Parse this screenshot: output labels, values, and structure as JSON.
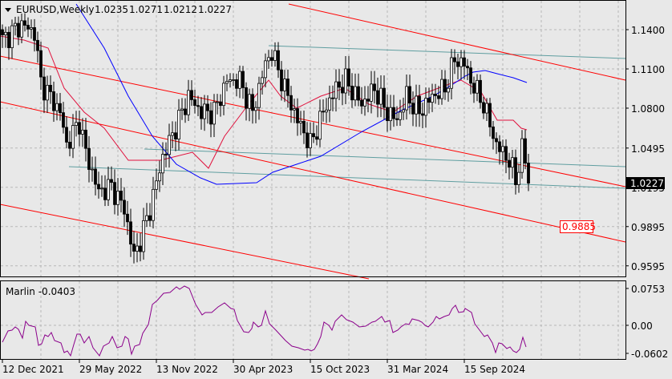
{
  "header": {
    "symbol": "EURUSD,Weekly",
    "open": "1.0235",
    "high": "1.0271",
    "low": "1.0212",
    "close": "1.0227"
  },
  "price_axis": [
    "1.1400",
    "1.1100",
    "1.0800",
    "1.0495",
    "1.0195",
    "0.9895",
    "0.9595"
  ],
  "current_price": "1.0227",
  "target_label": "0.9885",
  "indicator": {
    "label": "Marlin -0.0403",
    "axis": [
      "0.0753",
      "0.00",
      "-0.0602"
    ]
  },
  "time_axis": [
    "12 Dec 2021",
    "29 May 2022",
    "13 Nov 2022",
    "30 Apr 2023",
    "15 Oct 2023",
    "31 Mar 2024",
    "15 Sep 2024"
  ],
  "colors": {
    "bg": "#e8e8e8",
    "trend": "#ff0000",
    "channel": "#5f9ea0",
    "ma_fast": "#e0103c",
    "ma_slow": "#0000ff",
    "indicator": "#8b008b"
  },
  "price_waypoints": [
    [
      0,
      1.132
    ],
    [
      6,
      1.144
    ],
    [
      10,
      1.138
    ],
    [
      12,
      1.1
    ],
    [
      18,
      1.077
    ],
    [
      20,
      1.052
    ],
    [
      24,
      1.07
    ],
    [
      26,
      1.046
    ],
    [
      30,
      1.016
    ],
    [
      34,
      1.02
    ],
    [
      38,
      1.003
    ],
    [
      41,
      0.967
    ],
    [
      43,
      0.979
    ],
    [
      46,
      1.003
    ],
    [
      50,
      1.043
    ],
    [
      55,
      1.071
    ],
    [
      58,
      1.089
    ],
    [
      62,
      1.077
    ],
    [
      66,
      1.077
    ],
    [
      70,
      1.101
    ],
    [
      74,
      1.101
    ],
    [
      78,
      1.077
    ],
    [
      82,
      1.114
    ],
    [
      84,
      1.123
    ],
    [
      88,
      1.095
    ],
    [
      92,
      1.071
    ],
    [
      96,
      1.052
    ],
    [
      100,
      1.077
    ],
    [
      104,
      1.095
    ],
    [
      107,
      1.101
    ],
    [
      112,
      1.083
    ],
    [
      116,
      1.095
    ],
    [
      120,
      1.077
    ],
    [
      123,
      1.071
    ],
    [
      126,
      1.089
    ],
    [
      130,
      1.077
    ],
    [
      134,
      1.089
    ],
    [
      138,
      1.095
    ],
    [
      141,
      1.117
    ],
    [
      144,
      1.114
    ],
    [
      146,
      1.101
    ],
    [
      150,
      1.083
    ],
    [
      154,
      1.052
    ],
    [
      158,
      1.04
    ],
    [
      160,
      1.025
    ],
    [
      162,
      1.049
    ],
    [
      163,
      1.04
    ],
    [
      164,
      1.0227
    ]
  ]
}
